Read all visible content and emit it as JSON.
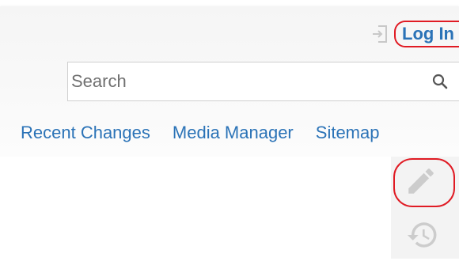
{
  "header": {
    "login_label": "Log In",
    "login_icon": "login-icon"
  },
  "search": {
    "placeholder": "Search",
    "value": "",
    "icon": "search-icon"
  },
  "nav": {
    "items": [
      {
        "label": "Recent Changes"
      },
      {
        "label": "Media Manager"
      },
      {
        "label": "Sitemap"
      }
    ]
  },
  "page_tools": {
    "items": [
      {
        "icon": "pencil-icon",
        "action": "edit"
      },
      {
        "icon": "history-icon",
        "action": "old-revisions"
      }
    ]
  },
  "colors": {
    "link": "#2b73b7",
    "highlight": "#e01b24",
    "icon_gray": "#cccccc"
  }
}
